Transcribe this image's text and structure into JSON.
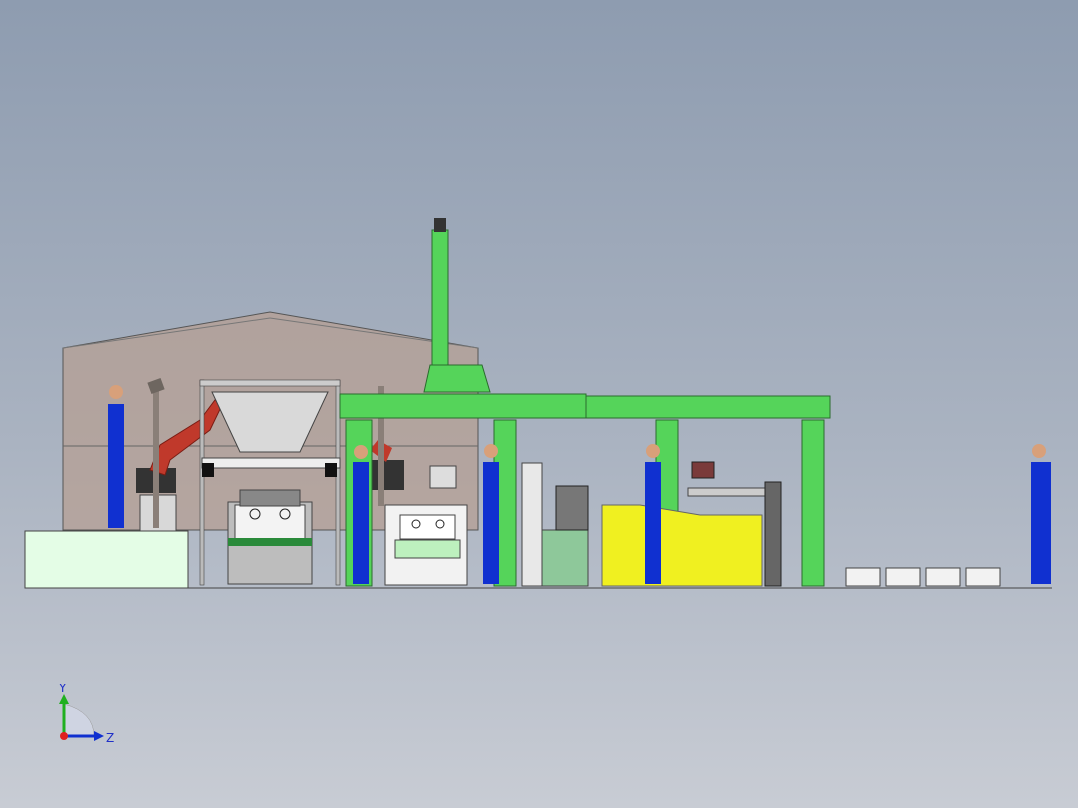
{
  "viewport": {
    "background_top": "#8e9cb0",
    "background_bottom": "#c8ccd4"
  },
  "scene": {
    "description_icon": "production-line-icon",
    "colors": {
      "frame_green": "#55d45a",
      "shed_fill": "#b59f93",
      "hopper": "#d9d9d9",
      "robot_red": "#c0392b",
      "yellow_conveyor": "#f0f020",
      "worker_blue": "#1030d0",
      "base_light": "#e4fde6",
      "outline": "#333333"
    }
  },
  "triad": {
    "y_label": "Y",
    "z_label": "Z",
    "icon": "axis-triad-icon"
  }
}
